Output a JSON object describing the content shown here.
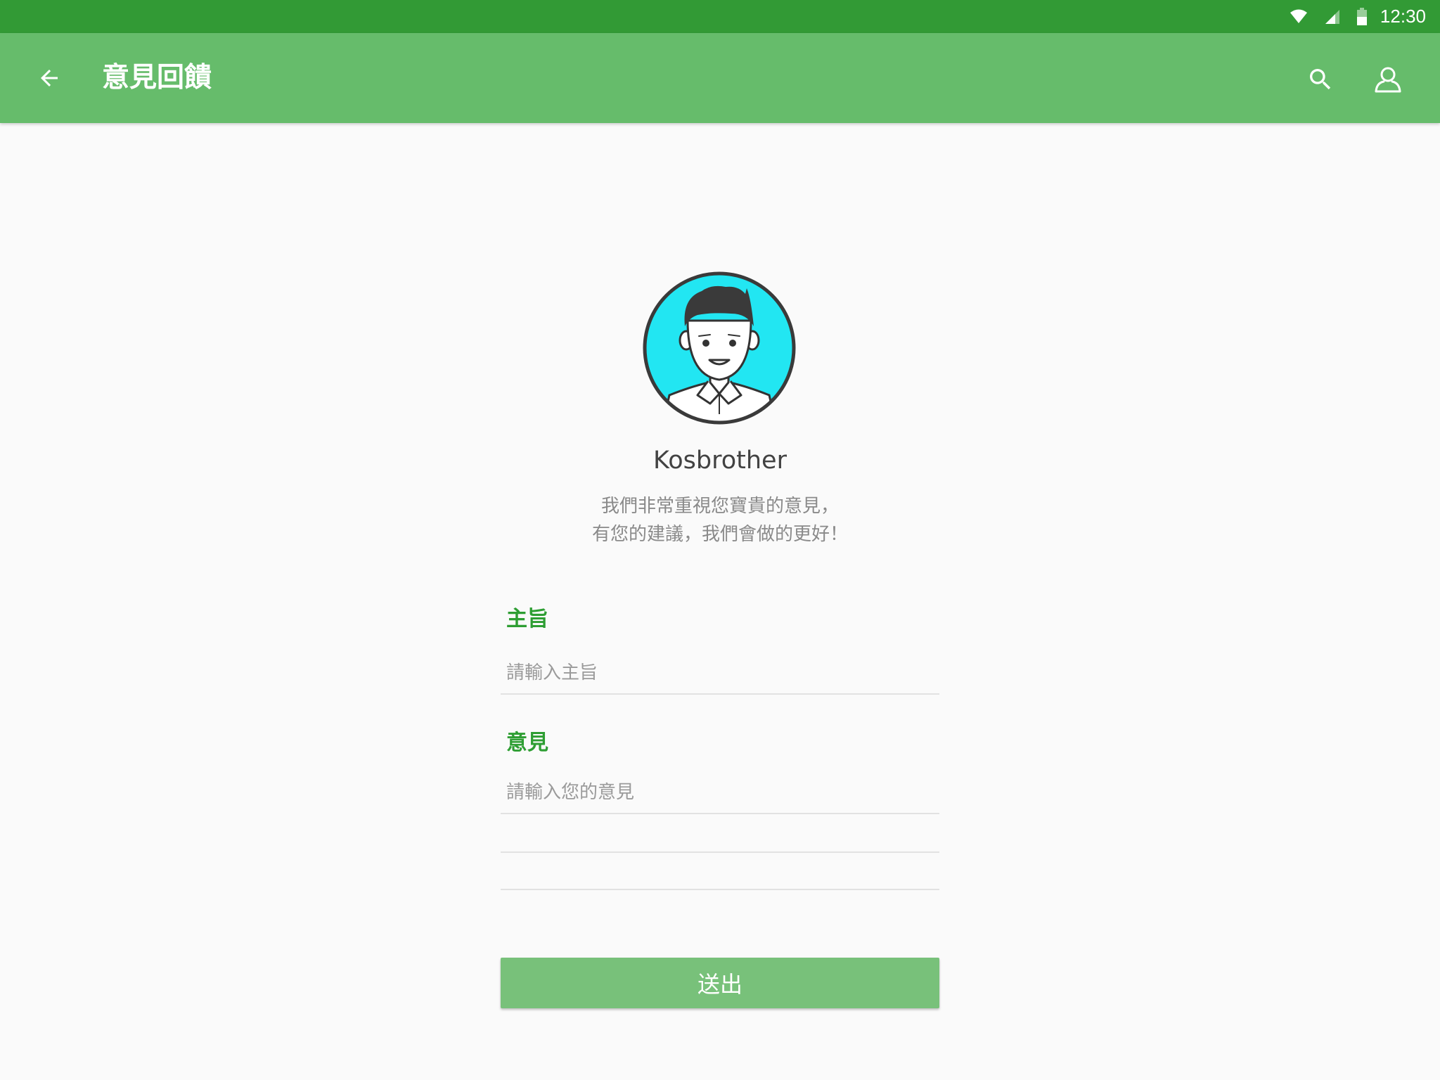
{
  "status_bar": {
    "time": "12:30",
    "icons": [
      "wifi-icon",
      "cell-signal-icon",
      "battery-icon"
    ]
  },
  "app_bar": {
    "title": "意見回饋",
    "back_icon": "arrow-back-icon",
    "actions": [
      "search-icon",
      "account-icon"
    ],
    "color": "#66bc6b",
    "status_color": "#329a35"
  },
  "profile": {
    "name": "Kosbrother",
    "intro_line1": "我們非常重視您寶貴的意見，",
    "intro_line2": "有您的建議，我們會做的更好！",
    "avatar_bg": "#22e6f2"
  },
  "form": {
    "subject_label": "主旨",
    "subject_placeholder": "請輸入主旨",
    "subject_value": "",
    "feedback_label": "意見",
    "feedback_placeholder": "請輸入您的意見",
    "feedback_value": "",
    "accent_color": "#2e9e33"
  },
  "submit": {
    "label": "送出",
    "color": "#78c17a"
  }
}
